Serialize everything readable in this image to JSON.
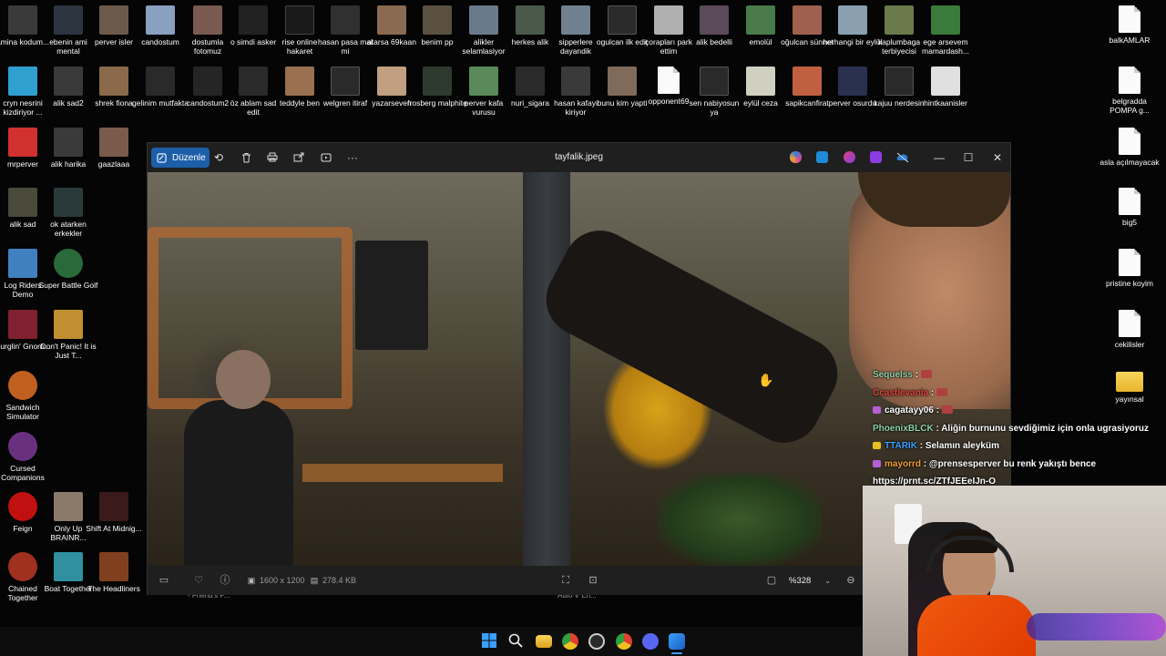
{
  "desktop": {
    "row1": [
      "amina kodum...",
      "ebenin ami mental",
      "perver isler",
      "candostum",
      "dostumla fotomuz",
      "o simdi asker",
      "rise online hakaret",
      "hasan pasa mal mi",
      "atarsa 69kaan",
      "benim pp",
      "alikler selamlasiyor",
      "herkes alik",
      "sipperlere dayandik",
      "ogulcan ilk edit",
      "çorapları park ettim",
      "alik bedelli",
      "emolül",
      "oğulcan sünnet",
      "herhangi bir eylül",
      "kaplumbaga terbiyecisi",
      "ege arsevem mamardash..."
    ],
    "row2": [
      "cryn nesrini kizdiriyor ...",
      "alik sad2",
      "shrek fiona",
      "gelinim mutfakta",
      "candostum2",
      "öz ablam sad edit",
      "teddyle ben",
      "welgren itiraf",
      "yazarseven",
      "frosberg malphite",
      "perver kafa vurusu",
      "nuri_sigara",
      "hasan kafayi kiriyor",
      "bunu kim yapti",
      "opponent69",
      "sen nabiyosun ya",
      "eylül ceza",
      "sapikcanfirat",
      "perver osurdu",
      "kajuu nerdesin",
      "hintkaanisler"
    ],
    "col1": [
      "mrperver",
      "alik sad",
      "Log Riders Demo",
      "Burglin' Gnom...",
      "Sandwich Simulator",
      "Cursed Companions",
      "Feign",
      "Chained Together"
    ],
    "col2": [
      "alik harika",
      "ok atarken erkekler",
      "Super Battle Golf",
      "Don't Panic! It is Just T...",
      "Only Up BRAINR...",
      "Boat Together"
    ],
    "col3": [
      "gaazlaaa",
      "Shift At Midnig...",
      "The Headliners"
    ],
    "right": [
      "balkAMLAR",
      "belgradda POMPA g...",
      "asla açılmayacak",
      "big5",
      "pristine koyim",
      "cekilisler",
      "yayınsal"
    ],
    "hidden_labels": [
      "- Friend's P...",
      "Auto V En..."
    ]
  },
  "photos": {
    "edit_label": "Düzenle",
    "file_title": "tayfalik.jpeg",
    "dimensions": "1600 x 1200",
    "file_size": "278.4 KB",
    "zoom": "%328"
  },
  "chat": [
    {
      "user": "Sequelss",
      "user_color": "#8fd3a8",
      "msg": "",
      "badge": ""
    },
    {
      "user": "Ccastlevania",
      "user_color": "#e0463c",
      "msg": "",
      "badge": ""
    },
    {
      "user": "cagatayy06",
      "user_color": "#ffffff",
      "msg": "",
      "badge": "#b45fd6"
    },
    {
      "user": "PhoenixBLCK",
      "user_color": "#8fd3a8",
      "msg": "Aliğin burnunu sevdiğimiz için onla ugrasiyoruz",
      "badge": ""
    },
    {
      "user": "TTARIK",
      "user_color": "#3aa0ff",
      "msg": "Selamın aleyküm",
      "badge": "#e6c020"
    },
    {
      "user": "mayorrd",
      "user_color": "#f0a030",
      "msg": "@prensesperver bu renk yakıştı bence",
      "badge": "#b45fd6"
    },
    {
      "user": "",
      "user_color": "#ffffff",
      "msg": "https://prnt.sc/ZTfJEEeIJn-O",
      "badge": ""
    }
  ],
  "colors": {
    "accent": "#1c5ea8",
    "titlebar": "#1f1f1f",
    "taskbar": "#0d0d0d"
  }
}
